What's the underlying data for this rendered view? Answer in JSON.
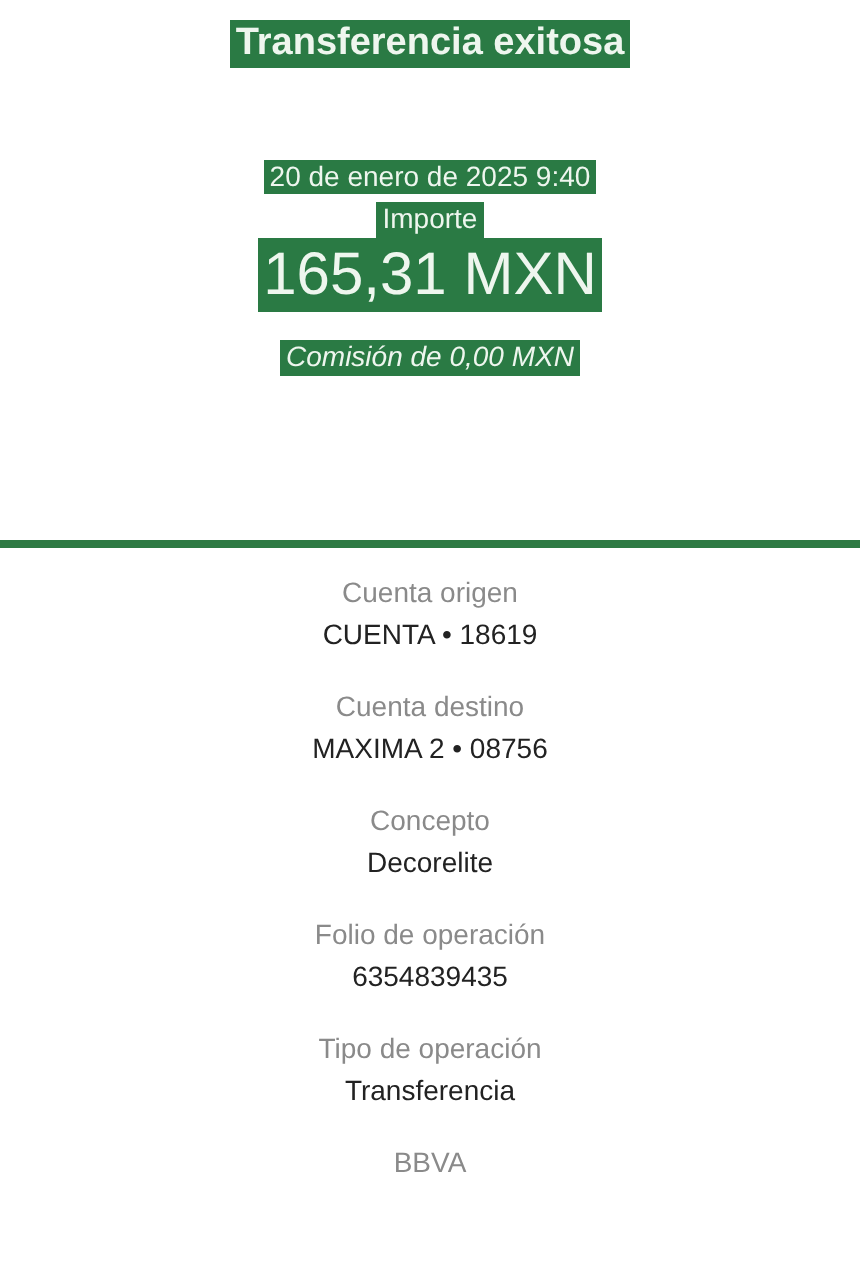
{
  "header": {
    "title": "Transferencia exitosa",
    "date": "20 de enero de 2025 9:40",
    "amount_label": "Importe",
    "amount": "165,31 MXN",
    "fee": "Comisión de 0,00 MXN"
  },
  "details": [
    {
      "label": "Cuenta origen",
      "value": "CUENTA • 18619"
    },
    {
      "label": "Cuenta destino",
      "value": "MAXIMA 2 • 08756"
    },
    {
      "label": "Concepto",
      "value": "Decorelite"
    },
    {
      "label": "Folio de operación",
      "value": "6354839435"
    },
    {
      "label": "Tipo de operación",
      "value": "Transferencia"
    }
  ],
  "footer": "BBVA"
}
